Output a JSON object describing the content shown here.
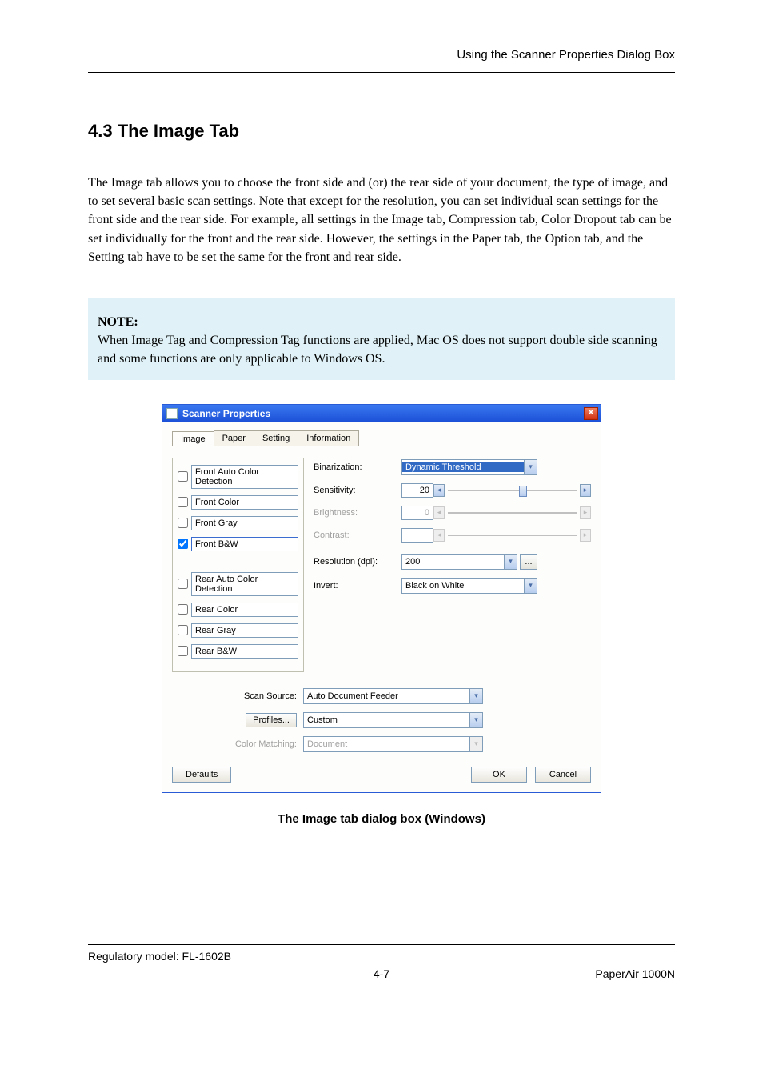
{
  "header": {
    "right_text": "Using the Scanner Properties Dialog Box"
  },
  "section": {
    "number_title": "4.3 The Image Tab",
    "para1": "The Image tab allows you to choose the front side and (or) the rear side of your document, the type of image, and to set several basic scan settings. Note that except for the resolution, you can set individual scan settings for the front side and the rear side. For example, all settings in the Image tab, Compression tab, Color Dropout tab can be set individually for the front and the rear side. However, the settings in the Paper tab, the Option tab, and the Setting tab have to be set the same for the front and rear side."
  },
  "note": {
    "title": "NOTE:",
    "text": "When Image Tag and Compression Tag functions are applied, Mac OS does not support double side scanning and some functions are only applicable to Windows OS."
  },
  "dialog": {
    "title": "Scanner Properties",
    "tabs": [
      "Image",
      "Paper",
      "Setting",
      "Information"
    ],
    "active_tab": "Image",
    "checkboxes_top": [
      {
        "key": "front_auto",
        "label": "Front Auto Color Detection",
        "checked": false
      },
      {
        "key": "front_color",
        "label": "Front Color",
        "checked": false
      },
      {
        "key": "front_gray",
        "label": "Front Gray",
        "checked": false
      },
      {
        "key": "front_bw",
        "label": "Front B&W",
        "checked": true
      }
    ],
    "checkboxes_bottom": [
      {
        "key": "rear_auto",
        "label": "Rear Auto Color Detection",
        "checked": false
      },
      {
        "key": "rear_color",
        "label": "Rear Color",
        "checked": false
      },
      {
        "key": "rear_gray",
        "label": "Rear Gray",
        "checked": false
      },
      {
        "key": "rear_bw",
        "label": "Rear B&W",
        "checked": false
      }
    ],
    "fields": {
      "binarization": {
        "label": "Binarization:",
        "value": "Dynamic Threshold"
      },
      "sensitivity": {
        "label": "Sensitivity:",
        "value": "20"
      },
      "brightness": {
        "label": "Brightness:",
        "value": "0"
      },
      "contrast": {
        "label": "Contrast:",
        "value": ""
      },
      "resolution": {
        "label": "Resolution (dpi):",
        "value": "200"
      },
      "invert": {
        "label": "Invert:",
        "value": "Black on White"
      },
      "scan_source": {
        "label": "Scan Source:",
        "value": "Auto Document Feeder"
      },
      "profiles": {
        "button": "Profiles...",
        "value": "Custom"
      },
      "color_matching": {
        "label": "Color Matching:",
        "value": "Document"
      }
    },
    "buttons": {
      "defaults": "Defaults",
      "ok": "OK",
      "cancel": "Cancel",
      "browse": "..."
    },
    "caption": "The Image tab dialog box (Windows)"
  },
  "footer": {
    "left": "Regulatory model: FL-1602B",
    "center": "",
    "right": "",
    "bottom_left": "",
    "bottom_center": "4-7",
    "bottom_right": "PaperAir 1000N"
  }
}
